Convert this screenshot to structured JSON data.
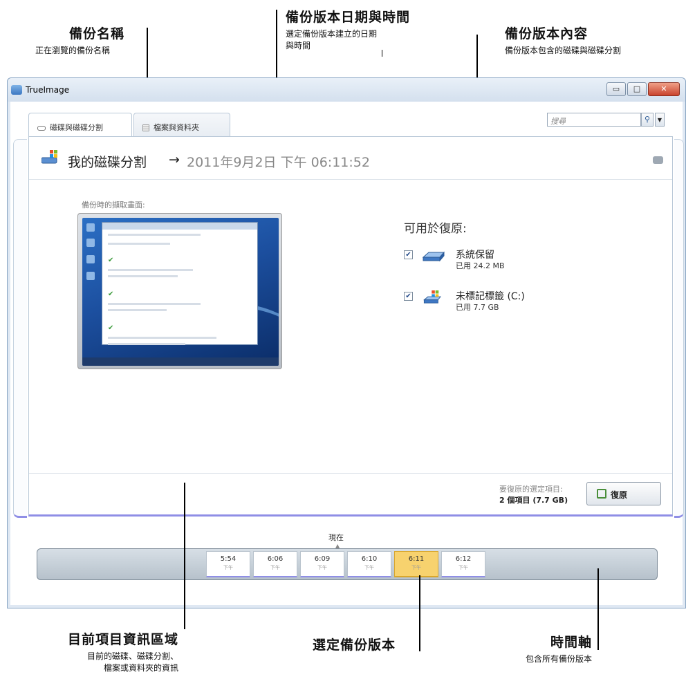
{
  "callouts": {
    "backup_name": {
      "title": "備份名稱",
      "desc": "正在瀏覽的備份名稱"
    },
    "version_datetime": {
      "title": "備份版本日期與時間",
      "desc1": "選定備份版本建立的日期",
      "desc2": "與時間"
    },
    "version_content": {
      "title": "備份版本內容",
      "desc": "備份版本包含的磁碟與磁碟分割"
    },
    "current_item_area": {
      "title": "目前項目資訊區域",
      "desc1": "目前的磁碟、磁碟分割、",
      "desc2": "檔案或資料夾的資訊"
    },
    "selected_version": {
      "title": "選定備份版本"
    },
    "timeline": {
      "title": "時間軸",
      "desc": "包含所有備份版本"
    }
  },
  "window": {
    "title": "TrueImage",
    "minimize_glyph": "▭",
    "maximize_glyph": "□",
    "close_glyph": "✕"
  },
  "tabs": [
    {
      "label": "磁碟與磁碟分割",
      "icon": "disk-icon"
    },
    {
      "label": "檔案與資料夾",
      "icon": "files-icon"
    }
  ],
  "search": {
    "placeholder": "搜尋",
    "icon": "search-icon"
  },
  "header": {
    "backup_name": "我的磁碟分割",
    "arrow": "→",
    "date_time": "2011年9月2日 下午 06:11:52",
    "icon": "windows-partition-icon"
  },
  "snapshot": {
    "label": "備份時的擷取畫面:"
  },
  "recovery": {
    "heading": "可用於復原:",
    "volumes": [
      {
        "name": "系統保留",
        "used": "已用 24.2 MB",
        "checked": true,
        "icon": "disk-drive-icon"
      },
      {
        "name": "未標記標籤 (C:)",
        "used": "已用 7.7 GB",
        "checked": true,
        "icon": "windows-drive-icon"
      }
    ]
  },
  "footer": {
    "selected_label": "要復原的選定項目:",
    "selected_count": "2 個項目 (7.7 GB)",
    "restore_button": "復原"
  },
  "timeline": {
    "now_label": "現在",
    "versions": [
      {
        "time": "5:54",
        "period": "下午",
        "selected": false
      },
      {
        "time": "6:06",
        "period": "下午",
        "selected": false
      },
      {
        "time": "6:09",
        "period": "下午",
        "selected": false
      },
      {
        "time": "6:10",
        "period": "下午",
        "selected": false
      },
      {
        "time": "6:11",
        "period": "下午",
        "selected": true
      },
      {
        "time": "6:12",
        "period": "下午",
        "selected": false
      }
    ]
  },
  "colors": {
    "accent": "#8f8ee6",
    "selected_version": "#f7d26e",
    "titlebar": "#d4e0ee"
  }
}
